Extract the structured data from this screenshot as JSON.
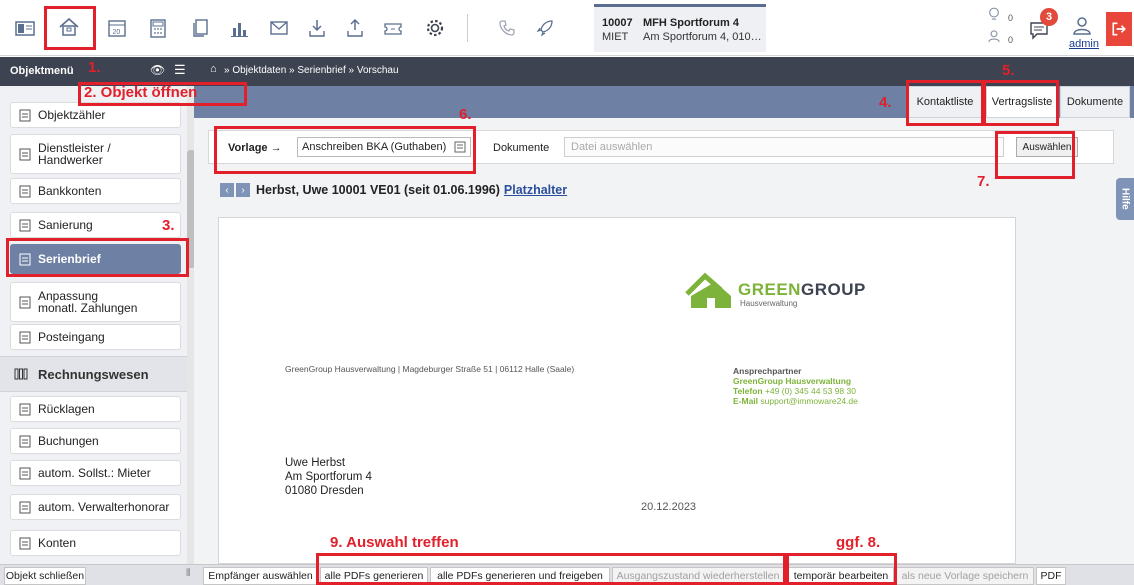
{
  "object": {
    "number": "10007",
    "type": "MIET",
    "name": "MFH Sportforum 4",
    "address": "Am Sportforum 4, 010…"
  },
  "header": {
    "counter1": "0",
    "counter2": "0",
    "notifications": "3",
    "user": "admin"
  },
  "navbar": {
    "menu_title": "Objektmenü",
    "breadcrumb": "» Objektdaten » Serienbrief » Vorschau"
  },
  "sidebar": {
    "items": [
      "Objektzähler",
      "Dienstleister / Handwerker",
      "Bankkonten",
      "Sanierung",
      "Serienbrief",
      "Anpassung monatl. Zahlungen",
      "Posteingang"
    ],
    "group": "Rechnungswesen",
    "items2": [
      "Rücklagen",
      "Buchungen",
      "autom. Sollst.: Mieter",
      "autom. Verwalterhonorar",
      "Konten"
    ]
  },
  "tabs": [
    "Kontaktliste",
    "Vertragsliste",
    "Dokumente"
  ],
  "vorlage": {
    "label": "Vorlage →",
    "value": "Anschreiben BKA (Guthaben)"
  },
  "documents": {
    "label": "Dokumente",
    "placeholder": "Datei auswählen",
    "button": "Auswählen"
  },
  "recipient": {
    "text": "Herbst, Uwe 10001 VE01 (seit 01.06.1996)",
    "link": "Platzhalter"
  },
  "side_tab": "Hilfe",
  "letter": {
    "logo_green": "GREEN",
    "logo_dark": "GROUP",
    "logo_sub": "Hausverwaltung",
    "sender": "GreenGroup Hausverwaltung | Magdeburger Straße 51 | 06112 Halle (Saale)",
    "contact_title": "Ansprechpartner",
    "contact_company": "GreenGroup Hausverwaltung",
    "phone_label": "Telefon",
    "phone": "+49 (0) 345 44 53 98 30",
    "email_label": "E-Mail",
    "email": "support@immoware24.de",
    "name": "Uwe Herbst",
    "street": "Am Sportforum 4",
    "city": "01080 Dresden",
    "date": "20.12.2023"
  },
  "bottom": {
    "close": "Objekt schließen",
    "buttons": [
      "Empfänger auswählen",
      "alle PDFs generieren",
      "alle PDFs generieren und freigeben",
      "Ausgangszustand wiederherstellen",
      "temporär bearbeiten",
      "als neue Vorlage speichern",
      "PDF"
    ]
  },
  "annotations": [
    "1.",
    "2. Objekt öffnen",
    "3.",
    "4.",
    "5.",
    "6.",
    "7.",
    "ggf. 8.",
    "9. Auswahl treffen"
  ],
  "colors": {
    "accent": "#6e80a3",
    "annotation": "#e1202b",
    "brand_green": "#7db33a"
  }
}
